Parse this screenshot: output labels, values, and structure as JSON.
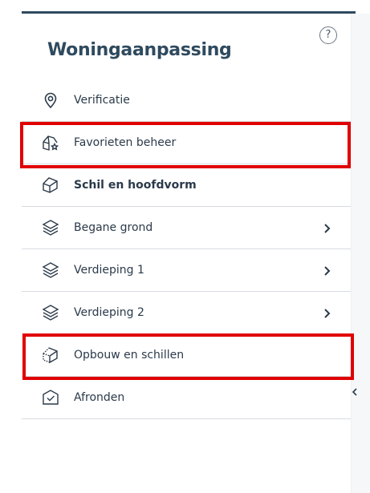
{
  "panel": {
    "title": "Woningaanpassing",
    "help_label": "?"
  },
  "menu": {
    "items": [
      {
        "label": "Verificatie",
        "icon": "location-pin-icon",
        "bold": false,
        "has_chevron": false
      },
      {
        "label": "Favorieten beheer",
        "icon": "house-star-icon",
        "bold": false,
        "has_chevron": false
      },
      {
        "label": "Schil en hoofdvorm",
        "icon": "house-outline-icon",
        "bold": true,
        "has_chevron": false
      },
      {
        "label": "Begane grond",
        "icon": "layers-icon",
        "bold": false,
        "has_chevron": true
      },
      {
        "label": "Verdieping 1",
        "icon": "layers-icon",
        "bold": false,
        "has_chevron": true
      },
      {
        "label": "Verdieping 2",
        "icon": "layers-icon",
        "bold": false,
        "has_chevron": true
      },
      {
        "label": "Opbouw en schillen",
        "icon": "house-dotted-icon",
        "bold": false,
        "has_chevron": false
      },
      {
        "label": "Afronden",
        "icon": "check-box-icon",
        "bold": false,
        "has_chevron": false
      }
    ]
  },
  "colors": {
    "title": "#2f4a5e",
    "highlight": "#e10000",
    "divider": "#d7dbe0"
  }
}
